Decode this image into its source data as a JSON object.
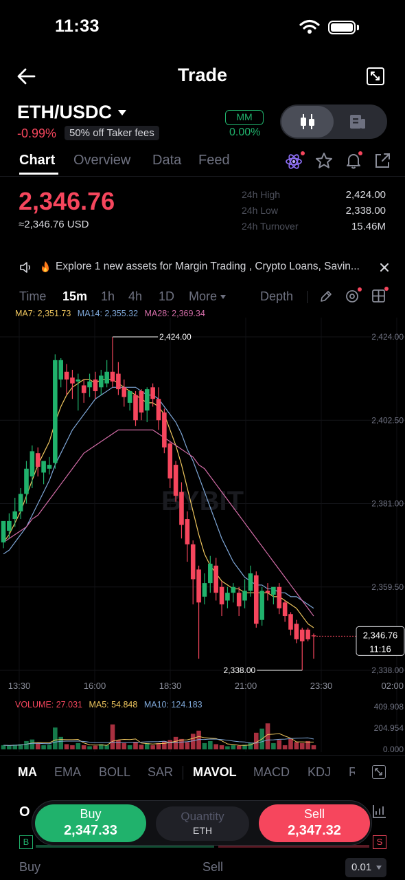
{
  "status_bar": {
    "time": "11:33"
  },
  "header": {
    "title": "Trade"
  },
  "pair": {
    "symbol": "ETH/USDC",
    "change": "-0.99%",
    "fee_badge": "50% off Taker fees",
    "mm_label": "MM",
    "mm_value": "0.00%"
  },
  "tabs": [
    "Chart",
    "Overview",
    "Data",
    "Feed"
  ],
  "price": {
    "last": "2,346.76",
    "usd": "≈2,346.76 USD",
    "stats": [
      {
        "label": "24h High",
        "value": "2,424.00"
      },
      {
        "label": "24h Low",
        "value": "2,338.00"
      },
      {
        "label": "24h Turnover",
        "value": "15.46M"
      }
    ]
  },
  "announcement": "Explore 1 new assets for Margin  Trading , Crypto Loans, Savin...",
  "intervals": {
    "time": "Time",
    "m15": "15m",
    "h1": "1h",
    "h4": "4h",
    "d1": "1D",
    "more": "More",
    "depth": "Depth"
  },
  "ma_legend": {
    "ma7": "MA7: 2,351.73",
    "ma14": "MA14: 2,355.32",
    "ma28": "MA28: 2,369.34"
  },
  "chart_data": {
    "type": "candlestick",
    "y_ticks": [
      "2,424.00",
      "2,402.50",
      "2,381.00",
      "2,359.50",
      "2,338.00"
    ],
    "ylim": [
      2338.0,
      2424.0
    ],
    "x_ticks": [
      "13:30",
      "16:00",
      "18:30",
      "21:00",
      "23:30",
      "02:00"
    ],
    "high_label": "2,424.00",
    "low_label": "2,338.00",
    "current_price_label": "2,346.76",
    "countdown_label": "11:16",
    "watermark": "BYBIT",
    "candles": [
      {
        "o": 2371.0,
        "h": 2373.0,
        "c": 2376.5,
        "l": 2369.5
      },
      {
        "o": 2374.0,
        "h": 2378.5,
        "c": 2376.5,
        "l": 2372.0
      },
      {
        "o": 2377.0,
        "h": 2382.5,
        "c": 2379.0,
        "l": 2375.0
      },
      {
        "o": 2379.0,
        "h": 2385.0,
        "c": 2383.5,
        "l": 2377.0
      },
      {
        "o": 2383.5,
        "h": 2392.0,
        "c": 2390.0,
        "l": 2381.0
      },
      {
        "o": 2388.0,
        "h": 2396.0,
        "c": 2394.5,
        "l": 2385.0
      },
      {
        "o": 2394.0,
        "h": 2395.5,
        "c": 2390.5,
        "l": 2388.0
      },
      {
        "o": 2389.0,
        "h": 2391.5,
        "c": 2392.0,
        "l": 2386.0
      },
      {
        "o": 2390.0,
        "h": 2393.0,
        "c": 2391.0,
        "l": 2388.5
      },
      {
        "o": 2391.5,
        "h": 2419.5,
        "c": 2418.0,
        "l": 2390.0
      },
      {
        "o": 2413.0,
        "h": 2418.5,
        "c": 2418.0,
        "l": 2411.0
      },
      {
        "o": 2415.0,
        "h": 2417.0,
        "c": 2413.0,
        "l": 2409.0
      },
      {
        "o": 2413.5,
        "h": 2415.5,
        "c": 2412.0,
        "l": 2408.0
      },
      {
        "o": 2412.5,
        "h": 2414.5,
        "c": 2413.0,
        "l": 2405.0
      },
      {
        "o": 2411.5,
        "h": 2413.0,
        "c": 2409.5,
        "l": 2407.0
      },
      {
        "o": 2411.0,
        "h": 2414.5,
        "c": 2412.5,
        "l": 2408.5
      },
      {
        "o": 2413.0,
        "h": 2415.0,
        "c": 2410.0,
        "l": 2408.0
      },
      {
        "o": 2411.0,
        "h": 2415.5,
        "c": 2414.0,
        "l": 2409.0
      },
      {
        "o": 2412.0,
        "h": 2418.0,
        "c": 2415.0,
        "l": 2411.0
      },
      {
        "o": 2415.0,
        "h": 2424.0,
        "c": 2412.5,
        "l": 2411.0
      },
      {
        "o": 2414.5,
        "h": 2417.5,
        "c": 2410.5,
        "l": 2409.0
      },
      {
        "o": 2411.0,
        "h": 2413.0,
        "c": 2408.5,
        "l": 2406.0
      },
      {
        "o": 2407.0,
        "h": 2409.5,
        "c": 2410.0,
        "l": 2405.0
      },
      {
        "o": 2409.0,
        "h": 2410.0,
        "c": 2402.5,
        "l": 2401.0
      },
      {
        "o": 2410.0,
        "h": 2410.5,
        "c": 2404.5,
        "l": 2402.5
      },
      {
        "o": 2405.0,
        "h": 2411.0,
        "c": 2410.5,
        "l": 2402.0
      },
      {
        "o": 2411.0,
        "h": 2412.0,
        "c": 2408.0,
        "l": 2406.0
      },
      {
        "o": 2408.0,
        "h": 2411.0,
        "c": 2402.5,
        "l": 2400.0
      },
      {
        "o": 2404.5,
        "h": 2405.5,
        "c": 2395.5,
        "l": 2394.0
      },
      {
        "o": 2396.5,
        "h": 2397.0,
        "c": 2387.5,
        "l": 2385.0
      },
      {
        "o": 2391.0,
        "h": 2392.0,
        "c": 2383.0,
        "l": 2381.5
      },
      {
        "o": 2384.0,
        "h": 2386.5,
        "c": 2375.5,
        "l": 2372.0
      },
      {
        "o": 2377.0,
        "h": 2379.0,
        "c": 2370.5,
        "l": 2366.0
      },
      {
        "o": 2370.5,
        "h": 2371.5,
        "c": 2361.5,
        "l": 2355.0
      },
      {
        "o": 2364.0,
        "h": 2365.0,
        "c": 2355.5,
        "l": 2341.0
      },
      {
        "o": 2357.0,
        "h": 2363.0,
        "c": 2360.5,
        "l": 2355.0
      },
      {
        "o": 2360.5,
        "h": 2367.5,
        "c": 2365.5,
        "l": 2358.0
      },
      {
        "o": 2365.0,
        "h": 2367.0,
        "c": 2358.0,
        "l": 2356.0
      },
      {
        "o": 2359.5,
        "h": 2361.0,
        "c": 2355.0,
        "l": 2352.0
      },
      {
        "o": 2356.0,
        "h": 2359.5,
        "c": 2358.0,
        "l": 2354.0
      },
      {
        "o": 2358.0,
        "h": 2360.5,
        "c": 2359.5,
        "l": 2355.5
      },
      {
        "o": 2358.0,
        "h": 2359.5,
        "c": 2354.5,
        "l": 2352.0
      },
      {
        "o": 2356.0,
        "h": 2361.5,
        "c": 2358.5,
        "l": 2354.0
      },
      {
        "o": 2358.5,
        "h": 2365.0,
        "c": 2363.0,
        "l": 2357.0
      },
      {
        "o": 2362.5,
        "h": 2363.5,
        "c": 2350.0,
        "l": 2349.0
      },
      {
        "o": 2351.0,
        "h": 2359.5,
        "c": 2358.5,
        "l": 2349.5
      },
      {
        "o": 2358.5,
        "h": 2360.5,
        "c": 2358.0,
        "l": 2356.0
      },
      {
        "o": 2357.5,
        "h": 2359.0,
        "c": 2359.5,
        "l": 2355.0
      },
      {
        "o": 2359.5,
        "h": 2360.5,
        "c": 2354.0,
        "l": 2352.5
      },
      {
        "o": 2355.5,
        "h": 2356.0,
        "c": 2352.0,
        "l": 2350.5
      },
      {
        "o": 2352.5,
        "h": 2353.0,
        "c": 2348.5,
        "l": 2347.0
      },
      {
        "o": 2350.0,
        "h": 2351.0,
        "c": 2346.0,
        "l": 2345.0
      },
      {
        "o": 2348.5,
        "h": 2349.0,
        "c": 2345.5,
        "l": 2338.0
      },
      {
        "o": 2348.5,
        "h": 2349.0,
        "c": 2346.0,
        "l": 2345.5
      },
      {
        "o": 2347.0,
        "h": 2347.5,
        "c": 2346.8,
        "l": 2341.0
      }
    ],
    "ma7": [
      2371,
      2373,
      2376,
      2379,
      2383,
      2387,
      2391,
      2394,
      2397,
      2402,
      2406,
      2409,
      2411,
      2412,
      2413,
      2413,
      2412,
      2413,
      2413,
      2413,
      2412,
      2411,
      2410,
      2409,
      2408,
      2407,
      2407,
      2406,
      2404,
      2400,
      2396,
      2391,
      2385,
      2379,
      2373,
      2368,
      2365,
      2363,
      2361,
      2360,
      2359,
      2359,
      2358,
      2358,
      2358,
      2358,
      2358,
      2357,
      2357,
      2356,
      2355,
      2354,
      2352,
      2350,
      2349
    ],
    "ma14": [
      2368,
      2369,
      2371,
      2373,
      2375,
      2378,
      2381,
      2384,
      2387,
      2391,
      2394,
      2397,
      2400,
      2402,
      2404,
      2406,
      2408,
      2409,
      2410,
      2411,
      2411,
      2411,
      2411,
      2411,
      2410,
      2409,
      2409,
      2408,
      2406,
      2404,
      2402,
      2399,
      2395,
      2392,
      2388,
      2384,
      2380,
      2376,
      2372,
      2369,
      2366,
      2364,
      2362,
      2361,
      2360,
      2360,
      2359,
      2359,
      2358,
      2358,
      2357,
      2357,
      2356,
      2355,
      2354
    ],
    "ma28": [
      2371,
      2372,
      2373,
      2374,
      2375,
      2377,
      2378,
      2380,
      2382,
      2384,
      2386,
      2388,
      2390,
      2392,
      2394,
      2395,
      2396,
      2397,
      2398,
      2399,
      2400,
      2400,
      2400,
      2400,
      2400,
      2400,
      2400,
      2399,
      2398,
      2397,
      2396,
      2395,
      2394,
      2393,
      2391,
      2390,
      2388,
      2386,
      2384,
      2382,
      2380,
      2378,
      2376,
      2374,
      2372,
      2370,
      2368,
      2366,
      2364,
      2362,
      2360,
      2358,
      2356,
      2354,
      2352
    ],
    "volume_legend": {
      "volume": "VOLUME: 27.031",
      "ma5": "MA5: 54.848",
      "ma10": "MA10: 124.183"
    },
    "volume_ticks": [
      "409.908",
      "204.954",
      "0.000"
    ],
    "volume_ylim": [
      0,
      409.908
    ],
    "volumes": [
      40,
      35,
      45,
      50,
      80,
      95,
      60,
      40,
      45,
      210,
      120,
      50,
      40,
      60,
      40,
      30,
      35,
      50,
      40,
      240,
      90,
      60,
      40,
      70,
      45,
      60,
      40,
      60,
      80,
      90,
      120,
      100,
      70,
      150,
      180,
      60,
      80,
      50,
      40,
      30,
      40,
      35,
      45,
      60,
      160,
      200,
      250,
      60,
      90,
      40,
      100,
      70,
      60,
      80,
      40
    ]
  },
  "indicators": [
    "MA",
    "EMA",
    "BOLL",
    "SAR",
    "MAVOL",
    "MACD",
    "KDJ",
    "R"
  ],
  "trade": {
    "buy_label": "Buy",
    "buy_price": "2,347.33",
    "qty_label": "Quantity",
    "qty_unit": "ETH",
    "sell_label": "Sell",
    "sell_price": "2,347.32"
  },
  "footer": {
    "buy": "Buy",
    "sell": "Sell",
    "step": "0.01"
  },
  "colors": {
    "up": "#20b26c",
    "down": "#f6465d",
    "ma7": "#f0c75e",
    "ma14": "#7fa8d9",
    "ma28": "#d46da8"
  }
}
